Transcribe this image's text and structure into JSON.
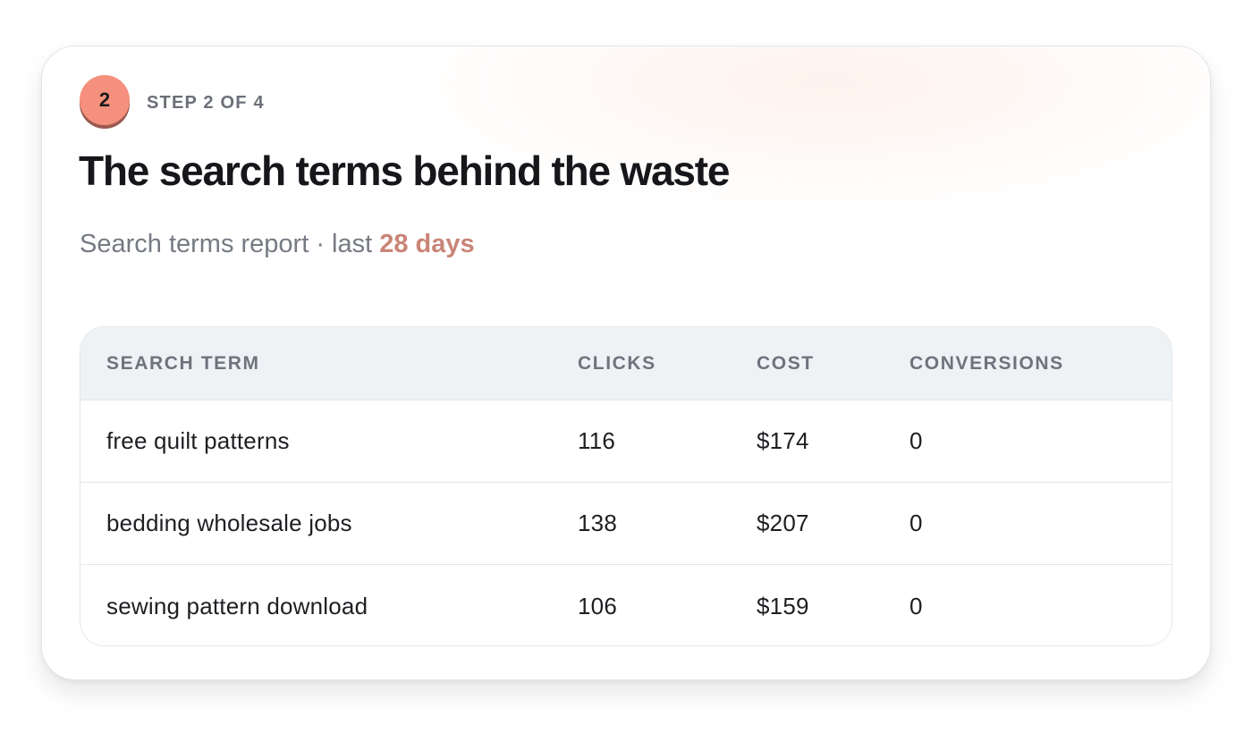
{
  "step": {
    "number": "2",
    "label": "STEP 2 OF 4"
  },
  "title": "The search terms behind the waste",
  "subtitle": {
    "prefix": "Search terms report · last ",
    "highlight": "28 days"
  },
  "colors": {
    "badge": "#f4907d",
    "highlight": "#c98577",
    "header_bg": "#eef2f5"
  },
  "table": {
    "headers": [
      "SEARCH TERM",
      "CLICKS",
      "COST",
      "CONVERSIONS"
    ],
    "rows": [
      {
        "term": "free quilt patterns",
        "clicks": "116",
        "cost": "$174",
        "conversions": "0"
      },
      {
        "term": "bedding wholesale jobs",
        "clicks": "138",
        "cost": "$207",
        "conversions": "0"
      },
      {
        "term": "sewing pattern download",
        "clicks": "106",
        "cost": "$159",
        "conversions": "0"
      }
    ]
  }
}
